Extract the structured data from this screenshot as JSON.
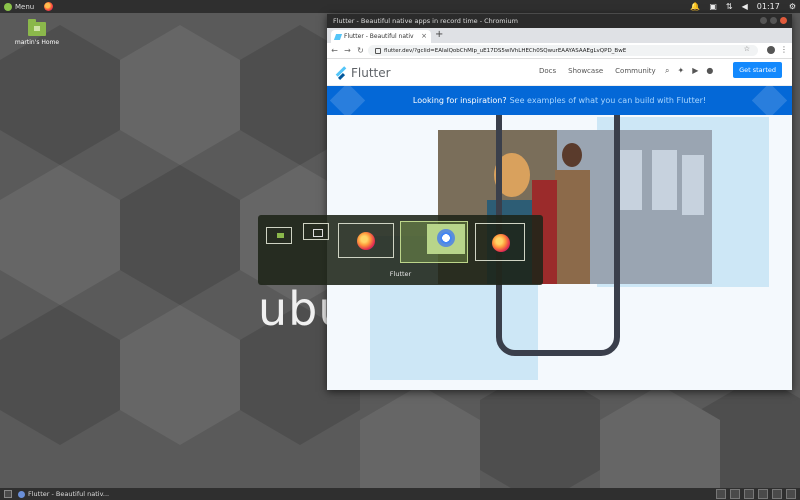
{
  "top_panel": {
    "menu_label": "Menu",
    "clock": "01:17"
  },
  "desktop": {
    "home_icon_label": "martin's Home",
    "wallpaper_text": "ubu"
  },
  "browser": {
    "window_title": "Flutter - Beautiful native apps in record time - Chromium",
    "tab_title": "Flutter - Beautiful nativ",
    "new_tab_symbol": "+",
    "url": "flutter.dev/?gclid=EAIaIQobChMIp_uE17DS5wIVhLHECh0SQwurEAAYASAAEgLvQPD_BwE"
  },
  "page": {
    "brand": "Flutter",
    "nav": [
      "Docs",
      "Showcase",
      "Community"
    ],
    "cta": "Get started",
    "banner_text": "Looking for inspiration?",
    "banner_link": "See examples of what you can build with Flutter!",
    "colors": {
      "brand_blue": "#0468d7",
      "cta_blue": "#1389fd",
      "flutter_light": "#54c5f8"
    }
  },
  "switcher": {
    "caption": "Flutter",
    "items": [
      "home-folder",
      "window",
      "firefox",
      "chromium",
      "firefox"
    ]
  },
  "bottom_panel": {
    "task_label": "Flutter - Beautiful nativ..."
  }
}
